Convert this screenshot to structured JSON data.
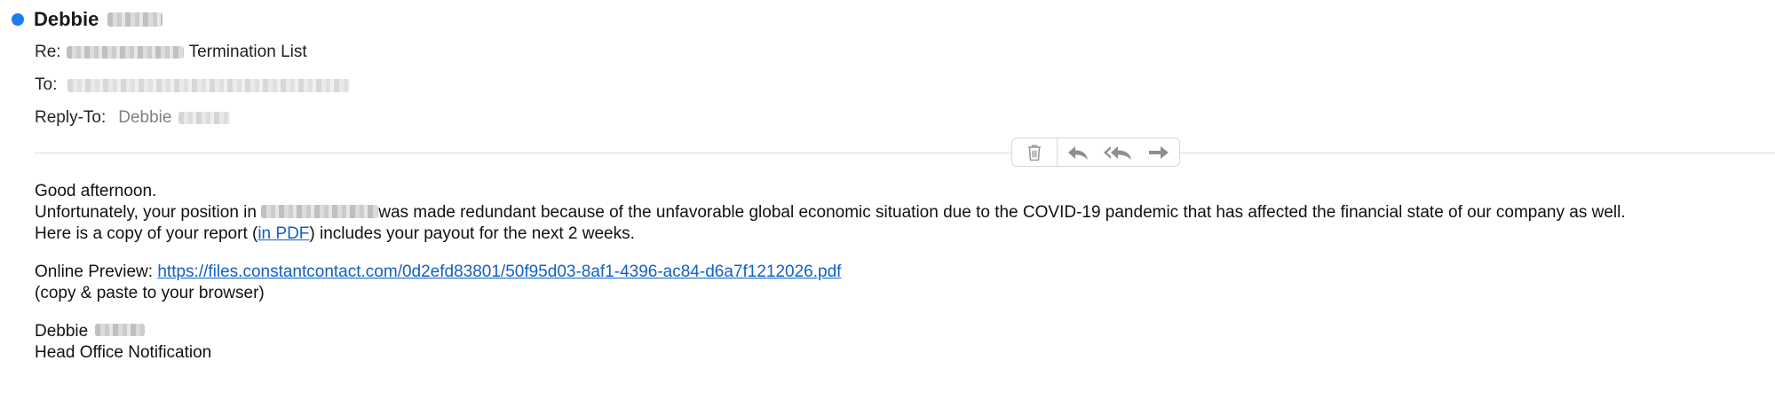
{
  "header": {
    "sender_first": "Debbie",
    "subject_prefix": "Re:",
    "subject_text": "Termination List",
    "to_label": "To:",
    "reply_to_label": "Reply-To:",
    "reply_to_name": "Debbie"
  },
  "toolbar": {
    "icons": [
      "trash-icon",
      "reply-icon",
      "reply-all-icon",
      "forward-icon"
    ]
  },
  "body": {
    "greeting": "Good afternoon.",
    "line1_before": "Unfortunately, your position in ",
    "line1_after": "was made redundant because of the unfavorable global economic situation due to the COVID-19 pandemic that has affected the financial state of our company as well.",
    "line2_before": "Here is a copy of your report (",
    "line2_link": "in PDF",
    "line2_after": ") includes your payout for the next 2 weeks.",
    "preview_label": "Online Preview: ",
    "preview_link": "https://files.constantcontact.com/0d2efd83801/50f95d03-8af1-4396-ac84-d6a7f1212026.pdf",
    "copy_hint": "(copy & paste to your browser)",
    "signoff_name": "Debbie",
    "signoff_title": "Head Office Notification"
  },
  "colors": {
    "unread_dot": "#1a7cf0",
    "link": "#1060c9",
    "divider": "#dcdcdc"
  }
}
